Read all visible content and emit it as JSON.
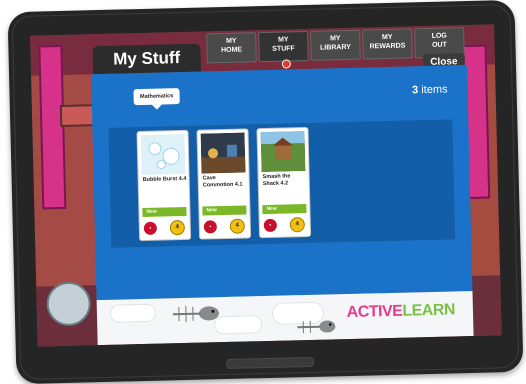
{
  "header": {
    "title": "My Stuff"
  },
  "nav": [
    {
      "label": "MY\nHOME"
    },
    {
      "label": "MY\nSTUFF"
    },
    {
      "label": "MY\nLIBRARY"
    },
    {
      "label": "MY\nREWARDS"
    },
    {
      "label": "LOG\nOUT"
    }
  ],
  "close": {
    "label": "Close"
  },
  "subject": {
    "label": "Mathematics"
  },
  "count": {
    "number": "3",
    "label": "items"
  },
  "cards": [
    {
      "title": "Bubble Burst 4.4",
      "badge": "New",
      "stars": "4"
    },
    {
      "title": "Cave Commotion 4.1",
      "badge": "New",
      "stars": "4"
    },
    {
      "title": "Smash the Shack 4.2",
      "badge": "New",
      "stars": "4"
    }
  ],
  "logo": {
    "text_a": "ACTIVE",
    "text_b": "LEARN"
  },
  "colors": {
    "panel": "#1b73c9",
    "new_badge": "#7ab828",
    "star_badge": "#f2c014",
    "red_badge": "#c8102e"
  }
}
